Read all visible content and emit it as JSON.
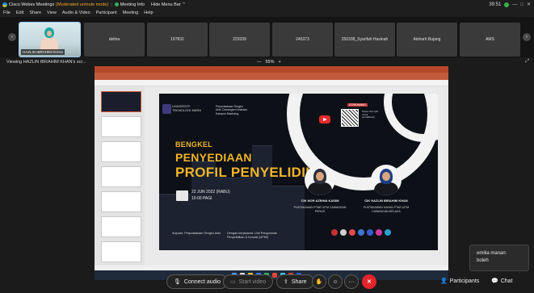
{
  "titlebar": {
    "app_name": "Cisco Webex Meetings",
    "moderated": "(Moderated unmute mode)",
    "meeting_info": "Meeting Info",
    "hide_menu": "Hide Menu Bar ⌃",
    "timer": "39:51",
    "minimize": "—",
    "maximize": "□",
    "close": "✕"
  },
  "menubar": [
    "File",
    "Edit",
    "Share",
    "View",
    "Audio & Video",
    "Participant",
    "Meeting",
    "Help"
  ],
  "participants": [
    {
      "name": "HAZLIN IBRAHIM KHAN",
      "video": true,
      "active": true
    },
    {
      "name": "delina"
    },
    {
      "name": "197832"
    },
    {
      "name": "229339"
    },
    {
      "name": "245373"
    },
    {
      "name": "250338_Syarifah Hasinah"
    },
    {
      "name": "Aisharh Bujang"
    },
    {
      "name": "AMS"
    }
  ],
  "viewbar": {
    "label": "Viewing HAZLIN IBRAHIM KHAN's scr...",
    "zoom_minus": "—",
    "zoom_value": "55%",
    "zoom_plus": "+",
    "expand": "⤢"
  },
  "slide": {
    "university": "UNIVERSITI TEKNOLOGI MARA",
    "ppk": "Perpustakaan Tengku Anis Cawangan Kelantan Kampus Machang",
    "bengkel": "BENGKEL",
    "penyediaan": "PENYEDIAAN",
    "profil": "PROFIL PENYELIDIK",
    "date": "22 JUN 2022 (RABU)",
    "time": "10:00 PAGI",
    "streaming": "STREAMING",
    "qr_text": "Poster dan QR untuk pendaftaran",
    "speaker1_name": "CIK NOR AZRINA KASIM",
    "speaker1_role": "PUSTAKAWAN PTAR UiTM CAWANGAN PERLIS",
    "speaker2_name": "CIK HAZLIN IBRAHIM KHAN",
    "speaker2_role": "PUSTAKAWAN KANAN PTAR UiTM CAWANGAN MELAKA",
    "anjuran": "Anjuran: Perpustakaan Tengku Anis",
    "kerjasama": "Dengan kerjasama: Unit Pengurusan Penyelidikan & Inovasi (UPMI)"
  },
  "chat_toast": {
    "sender": "emilia manan:",
    "message": "boleh"
  },
  "controls": {
    "connect_audio": "Connect audio",
    "start_video": "Start video",
    "share": "Share",
    "participants": "Participants",
    "chat": "Chat",
    "more": "···"
  },
  "colors": {
    "end_button": "#e3242b",
    "slide_accent": "#f0b52a",
    "ppt_ribbon": "#b7472a"
  }
}
